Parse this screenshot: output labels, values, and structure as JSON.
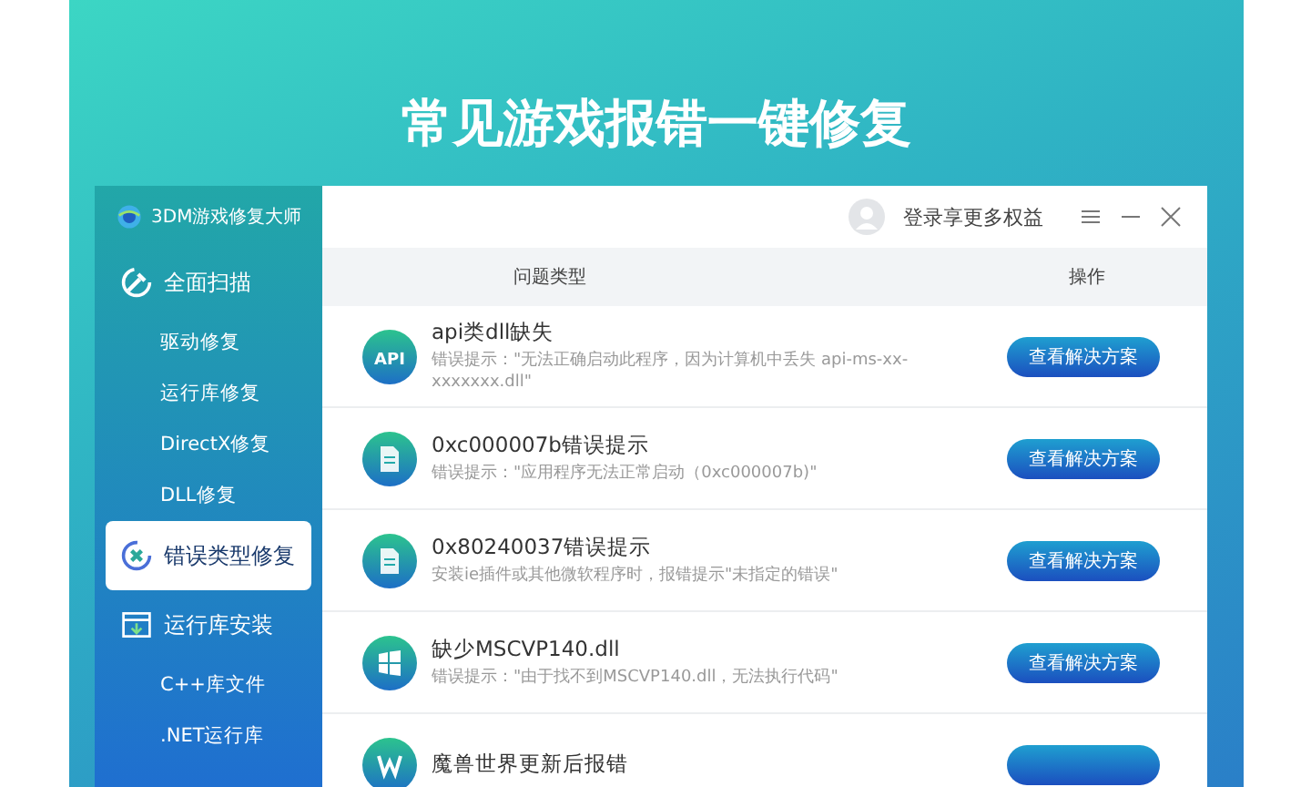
{
  "headline": "常见游戏报错一键修复",
  "window": {
    "title": "3DM游戏修复大师",
    "login": "登录享更多权益"
  },
  "sidebar": {
    "items": [
      {
        "label": "全面扫描",
        "kind": "section",
        "selected": false
      },
      {
        "label": "驱动修复",
        "kind": "sub",
        "selected": false
      },
      {
        "label": "运行库修复",
        "kind": "sub",
        "selected": false
      },
      {
        "label": "DirectX修复",
        "kind": "sub",
        "selected": false
      },
      {
        "label": "DLL修复",
        "kind": "sub",
        "selected": false
      },
      {
        "label": "错误类型修复",
        "kind": "section",
        "selected": true
      },
      {
        "label": "运行库安装",
        "kind": "section",
        "selected": false
      },
      {
        "label": "C++库文件",
        "kind": "sub",
        "selected": false
      },
      {
        "label": ".NET运行库",
        "kind": "sub",
        "selected": false
      }
    ]
  },
  "table": {
    "columns": [
      "问题类型",
      "操作"
    ],
    "rows": [
      {
        "kind": "api",
        "icon_text": "API",
        "title": "api类dll缺失",
        "desc": "错误提示：\"无法正确启动此程序，因为计算机中丢失 api-ms-xx-xxxxxxx.dll\"",
        "button": "查看解决方案"
      },
      {
        "kind": "doc",
        "title": "0xc000007b错误提示",
        "desc": "错误提示：\"应用程序无法正常启动（0xc000007b)\"",
        "button": "查看解决方案"
      },
      {
        "kind": "doc",
        "title": "0x80240037错误提示",
        "desc": "安装ie插件或其他微软程序时，报错提示\"未指定的错误\"",
        "button": "查看解决方案"
      },
      {
        "kind": "windows",
        "title": "缺少MSCVP140.dll",
        "desc": "错误提示：\"由于找不到MSCVP140.dll，无法执行代码\"",
        "button": "查看解决方案"
      },
      {
        "kind": "game",
        "title": "魔兽世界更新后报错"
      }
    ]
  }
}
